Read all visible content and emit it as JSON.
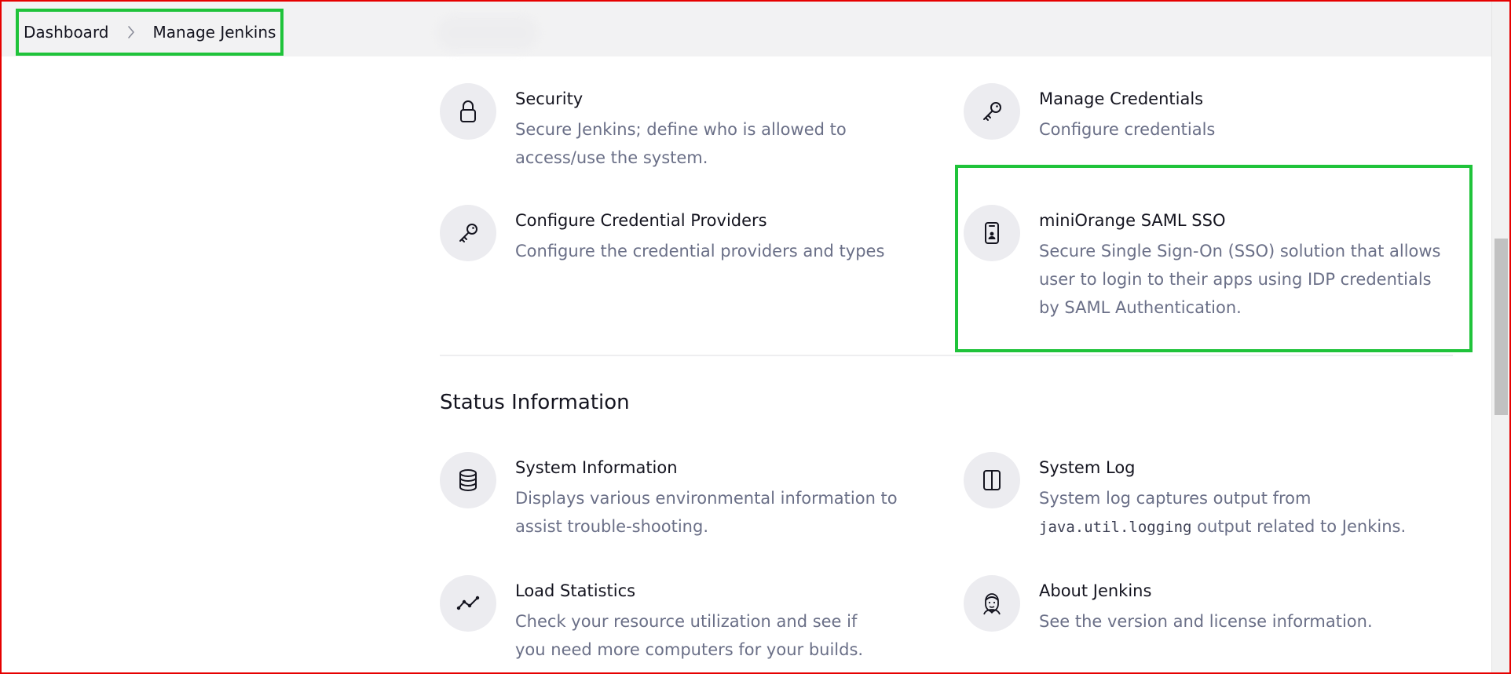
{
  "breadcrumb": {
    "items": [
      "Dashboard",
      "Manage Jenkins"
    ]
  },
  "security_section": {
    "items": [
      {
        "title": "Security",
        "description": "Secure Jenkins; define who is allowed to access/use the system.",
        "icon": "lock-icon"
      },
      {
        "title": "Manage Credentials",
        "description": "Configure credentials",
        "icon": "key-icon"
      },
      {
        "title": "Configure Credential Providers",
        "description": "Configure the credential providers and types",
        "icon": "key-icon"
      },
      {
        "title": "miniOrange SAML SSO",
        "description": "Secure Single Sign-On (SSO) solution that allows user to login to their apps using IDP credentials by SAML Authentication.",
        "icon": "id-badge-icon"
      }
    ]
  },
  "status_section": {
    "heading": "Status Information",
    "items": [
      {
        "title": "System Information",
        "description": "Displays various environmental information to assist trouble-shooting.",
        "icon": "database-icon"
      },
      {
        "title": "System Log",
        "description_prefix": "System log captures output from",
        "description_code": "java.util.logging",
        "description_suffix": "output related to Jenkins.",
        "icon": "sidebar-panel-icon"
      },
      {
        "title": "Load Statistics",
        "description": "Check your resource utilization and see if you need more computers for your builds.",
        "icon": "line-graph-icon"
      },
      {
        "title": "About Jenkins",
        "description": "See the version and license information.",
        "icon": "jenkins-butler-icon"
      }
    ]
  },
  "colors": {
    "highlight": "#1fc33a",
    "frame": "#e60000",
    "description_text": "#6a6f87",
    "icon_circle": "#ececf0"
  }
}
